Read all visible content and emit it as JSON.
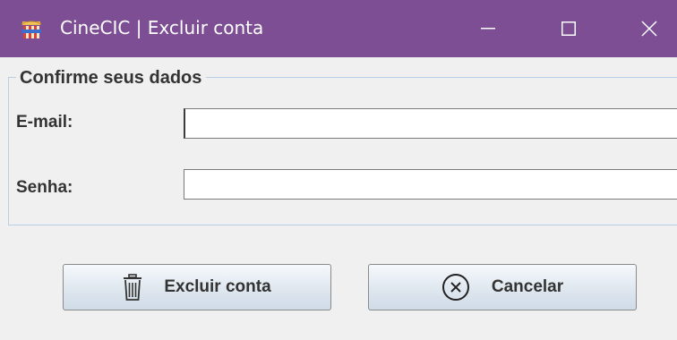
{
  "window": {
    "title": "CineCIC | Excluir conta",
    "titlebar_color": "#7d4e93",
    "icons": [
      "app-icon",
      "minimize-icon",
      "maximize-icon",
      "close-icon"
    ]
  },
  "form": {
    "legend": "Confirme seus dados",
    "email_label": "E-mail:",
    "email_value": "",
    "senha_label": "Senha:",
    "senha_value": ""
  },
  "buttons": {
    "excluir_label": "Excluir conta",
    "excluir_icon": "trash-icon",
    "cancelar_label": "Cancelar",
    "cancelar_icon": "cancel-circle-icon"
  }
}
